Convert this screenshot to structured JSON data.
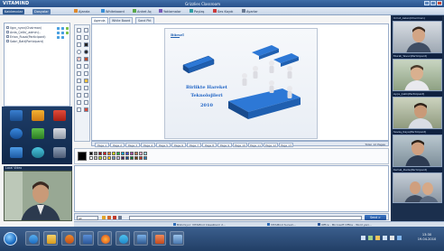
{
  "window": {
    "logo": "VITAMIND",
    "title": "Grizzlies  Classroom"
  },
  "menu": {
    "tabs": [
      "Katılımcılar",
      "Dosyalar"
    ],
    "items": [
      "Ajanda",
      "Whiteboard",
      "Anket Aç",
      "Yoklamalar",
      "Paylaş",
      "Ses Kaydı",
      "Ayarlar"
    ]
  },
  "participants": [
    "Ilgın_nyan(Chairman)",
    "Arda_Çelik(_admin)..",
    "Ertan_Rusal(Participant)",
    "Sabri_Batt(Participant)"
  ],
  "local_camera_label": "Local Video",
  "doc_tabs": [
    "Agenda",
    "White Board",
    "Sand Pkt"
  ],
  "slide": {
    "brand": "Bürsel",
    "title_lines": [
      "Birlikte Hareket",
      "Teknolojileri",
      "2010"
    ]
  },
  "pages": {
    "tabs": [
      "Page 1",
      "Page 2",
      "Page 3",
      "Page 4",
      "Page 5",
      "Page 6",
      "Page 7",
      "Page 8",
      "Page 9",
      "Page 10",
      "Page 11",
      "Page 12",
      "Page 13"
    ],
    "count": "Total: 12 Pages"
  },
  "chat": {
    "target": "all",
    "send_label": "Send >"
  },
  "status_items": [
    "Bilinmiyor: VITAMind ClassRoom 2...",
    "VITAMind Sunum...",
    "Office - Microsoft Office - Word yeni..."
  ],
  "right_videos": [
    "Umut_Aslan(Chairman)",
    "Murat_Yavuz(Participant)",
    "Ayça_Çelik(Participant)",
    "Savaş_Kaya(Participant)",
    "Kemal_Dede(Participant)"
  ],
  "clock": {
    "time": "13:30",
    "date": "19.04.2010"
  },
  "colors": {
    "accent": "#2f5a91",
    "taskbar": "#2c4b74",
    "slide_title": "#1e63c5",
    "puzzle_blue": "#2d78d6"
  }
}
